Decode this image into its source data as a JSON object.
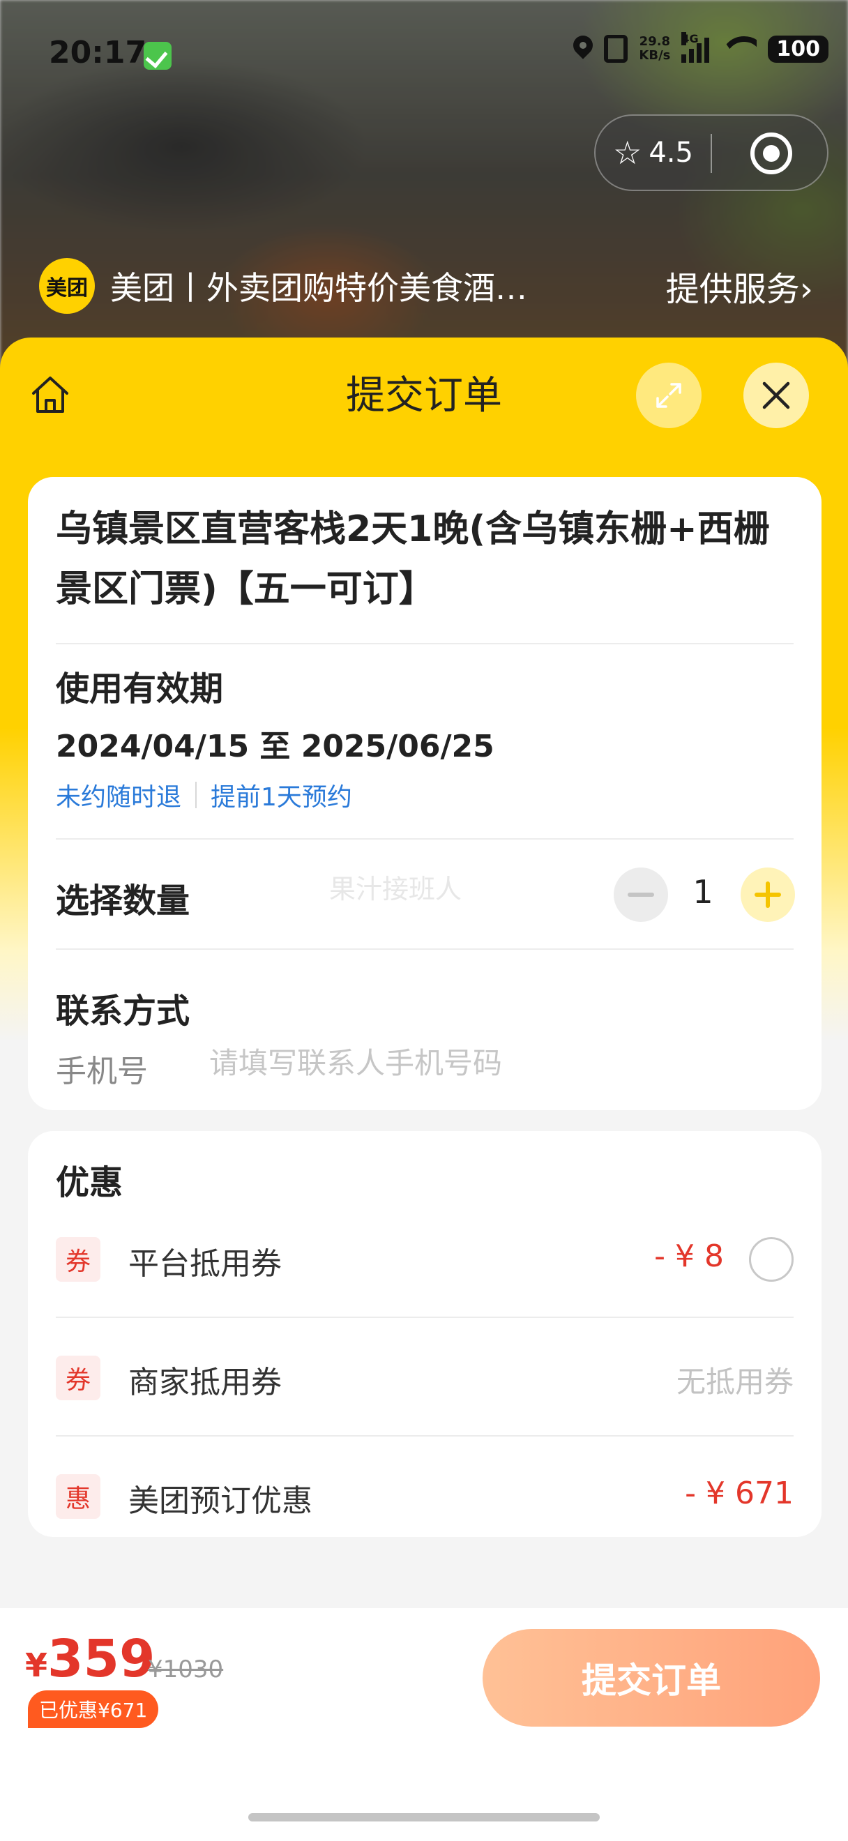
{
  "status_bar": {
    "time": "20:17",
    "net_speed_value": "29.8",
    "net_speed_unit": "KB/s",
    "network_type": "4G",
    "battery": "100"
  },
  "header": {
    "rating": "4.5",
    "merchant_logo_text": "美团",
    "merchant_name": "美团丨外卖团购特价美食酒…",
    "service_link": "提供服务›"
  },
  "sheet": {
    "title": "提交订单"
  },
  "product": {
    "title": "乌镇景区直营客栈2天1晚(含乌镇东栅+西栅景区门票)【五一可订】"
  },
  "validity": {
    "label": "使用有效期",
    "dates": "2024/04/15 至 2025/06/25",
    "tags": [
      "未约随时退",
      "提前1天预约"
    ]
  },
  "quantity": {
    "label": "选择数量",
    "value": "1",
    "watermark": "果汁接班人"
  },
  "contact": {
    "label": "联系方式",
    "phone_label": "手机号",
    "phone_value": "",
    "phone_placeholder": "请填写联系人手机号码"
  },
  "discounts": {
    "title": "优惠",
    "items": [
      {
        "badge": "券",
        "label": "平台抵用券",
        "amount": "- ¥ 8"
      },
      {
        "badge": "券",
        "label": "商家抵用券",
        "amount": "无抵用券"
      },
      {
        "badge": "惠",
        "label": "美团预订优惠",
        "amount": "- ¥ 671"
      }
    ]
  },
  "footer": {
    "currency": "¥",
    "price": "359",
    "original_price": "¥1030",
    "saved": "已优惠¥671",
    "submit_label": "提交订单"
  },
  "colors": {
    "brand_yellow": "#ffd100",
    "price_red": "#e3362a",
    "link_blue": "#2a7ad9",
    "submit_gradient_start": "#ffc196",
    "submit_gradient_end": "#ffa27a"
  }
}
